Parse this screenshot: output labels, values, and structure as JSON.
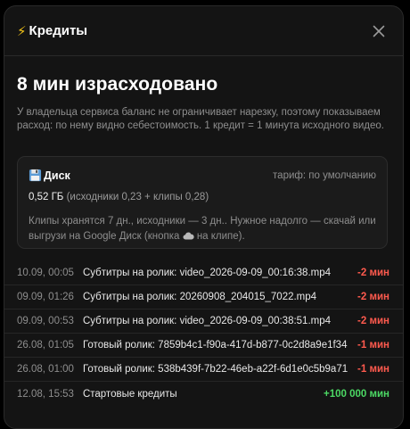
{
  "dialog": {
    "icon": "lightning-icon",
    "title": "Кредиты",
    "close_icon": "close-icon",
    "headline": "8 мин израсходовано",
    "description": "У владельца сервиса баланс не ограничивает нарезку, поэтому показываем расход: по нему видно себестоимость. 1 кредит = 1 минута исходного видео."
  },
  "disk": {
    "icon": "floppy-disk-icon",
    "title": "Диск",
    "tariff": "тариф: по умолчанию",
    "used": "0,52 ГБ",
    "breakdown": "(исходники 0,23 + клипы 0,28)",
    "note_before": "Клипы хранятся 7 дн., исходники — 3 дн.. Нужное надолго — скачай или выгрузи на Google Диск (кнопка",
    "note_icon": "cloud-icon",
    "note_after": "на клипе)."
  },
  "transactions": [
    {
      "date": "10.09, 00:05",
      "label": "Субтитры на ролик: video_2026-09-09_00:16:38.mp4",
      "amount": "-2 мин",
      "kind": "neg"
    },
    {
      "date": "09.09, 01:26",
      "label": "Субтитры на ролик: 20260908_204015_7022.mp4",
      "amount": "-2 мин",
      "kind": "neg"
    },
    {
      "date": "09.09, 00:53",
      "label": "Субтитры на ролик: video_2026-09-09_00:38:51.mp4",
      "amount": "-2 мин",
      "kind": "neg"
    },
    {
      "date": "26.08, 01:05",
      "label": "Готовый ролик: 7859b4c1-f90a-417d-b877-0c2d8a9e1f34",
      "amount": "-1 мин",
      "kind": "neg"
    },
    {
      "date": "26.08, 01:00",
      "label": "Готовый ролик: 538b439f-7b22-46eb-a22f-6d1e0c5b9a71",
      "amount": "-1 мин",
      "kind": "neg"
    },
    {
      "date": "12.08, 15:53",
      "label": "Стартовые кредиты",
      "amount": "+100 000 мин",
      "kind": "pos"
    }
  ],
  "colors": {
    "negative": "#ff5a4e",
    "positive": "#4cd964",
    "accent_bolt": "#f5c518"
  }
}
